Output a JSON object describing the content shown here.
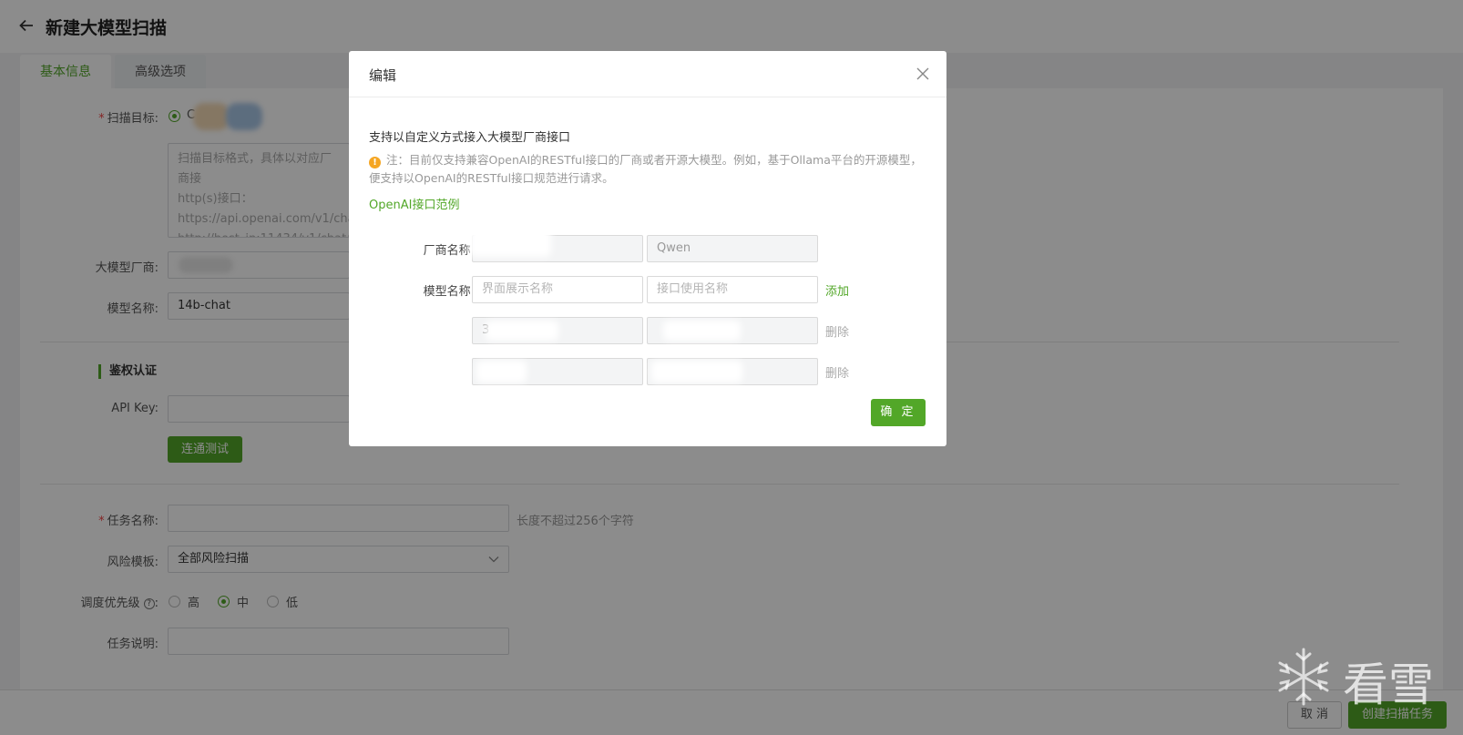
{
  "page": {
    "title": "新建大模型扫描",
    "tabs": [
      "基本信息",
      "高级选项"
    ],
    "form": {
      "scan_target_label": "扫描目标:",
      "scan_target_option": "C",
      "scan_target_textarea_lines": [
        "扫描目标格式，具体以对应厂商接",
        "http(s)接口：",
        "https://api.openai.com/v1/chat/co",
        "http://host_ip:11434/v1/chat/com"
      ],
      "vendor_label": "大模型厂商:",
      "vendor_value": "",
      "model_label": "模型名称:",
      "model_value": "14b-chat",
      "auth_section_title": "鉴权认证",
      "api_key_label": "API Key:",
      "connect_test_label": "连通测试",
      "task_name_label": "任务名称:",
      "task_name_hint": "长度不超过256个字符",
      "risk_template_label": "风险模板:",
      "risk_template_value": "全部风险扫描",
      "priority_label": "调度优先级",
      "priority_options": [
        "高",
        "中",
        "低"
      ],
      "priority_selected": "中",
      "task_desc_label": "任务说明:"
    },
    "footer": {
      "cancel_label": "取 消",
      "create_label": "创建扫描任务"
    }
  },
  "modal": {
    "title": "编辑",
    "description": "支持以自定义方式接入大模型厂商接口",
    "note": "注：目前仅支持兼容OpenAI的RESTful接口的厂商或者开源大模型。例如，基于Ollama平台的开源模型，便支持以OpenAI的RESTful接口规范进行请求。",
    "example_link": "OpenAI接口范例",
    "vendor_label": "厂商名称:",
    "vendor_display": "",
    "vendor_api": "Qwen",
    "model_label": "模型名称:",
    "model_display_placeholder": "界面展示名称",
    "model_api_placeholder": "接口使用名称",
    "add_label": "添加",
    "rows": [
      {
        "display": "3",
        "api": "",
        "delete_label": "删除"
      },
      {
        "display": "",
        "api": "",
        "delete_label": "删除"
      }
    ],
    "ok_label": "确 定"
  },
  "watermark": {
    "text": "看雪"
  },
  "colors": {
    "accent": "#52a728",
    "warning": "#f5a623",
    "required": "#ee4444"
  }
}
